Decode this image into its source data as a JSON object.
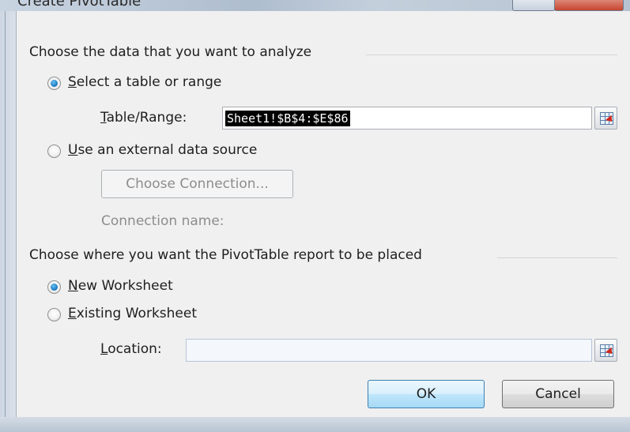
{
  "window": {
    "title": "Create PivotTable"
  },
  "section_data": {
    "title": "Choose the data that you want to analyze",
    "option_table": {
      "mnemonic": "S",
      "label_rest": "elect a table or range",
      "checked": true
    },
    "table_range": {
      "mnemonic": "T",
      "label_rest": "able/Range:",
      "value": "Sheet1!$B$4:$E$86"
    },
    "option_external": {
      "mnemonic": "U",
      "label_rest": "se an external data source",
      "checked": false
    },
    "choose_connection_label": "Choose Connection...",
    "connection_name_label": "Connection name:"
  },
  "section_place": {
    "title": "Choose where you want the PivotTable report to be placed",
    "option_new": {
      "mnemonic": "N",
      "label_rest": "ew Worksheet",
      "checked": true
    },
    "option_existing": {
      "mnemonic": "E",
      "label_rest": "xisting Worksheet",
      "checked": false
    },
    "location": {
      "mnemonic": "L",
      "label_rest": "ocation:",
      "value": ""
    }
  },
  "buttons": {
    "ok_label": "OK",
    "cancel_label": "Cancel"
  },
  "icons": {
    "range_picker": "range-picker-icon"
  },
  "colors": {
    "selection": "#000000",
    "radio_checked": "#1f7fc5",
    "default_button_border": "#3c7fb1"
  }
}
